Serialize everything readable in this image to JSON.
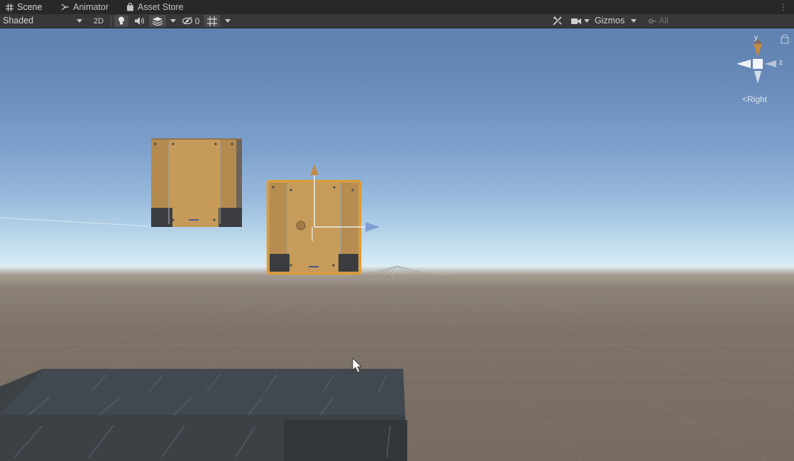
{
  "tabs": [
    {
      "label": "Scene",
      "icon": "grid-icon",
      "active": true
    },
    {
      "label": "Animator",
      "icon": "animator-icon",
      "active": false
    },
    {
      "label": "Asset Store",
      "icon": "bag-icon",
      "active": false
    }
  ],
  "toolbar": {
    "shading_mode": "Shaded",
    "mode_2d": "2D",
    "hidden_count": "0",
    "gizmos": "Gizmos",
    "search_placeholder": "All"
  },
  "orientation_gizmo": {
    "axis_y": "y",
    "axis_z": "z",
    "view_label": "Right"
  },
  "colors": {
    "accent": "#3d6fb7",
    "handle_y": "#c28a45",
    "handle_x": "#7f9fd4",
    "crate": "#c79c5a",
    "selection": "#e29a2c"
  }
}
